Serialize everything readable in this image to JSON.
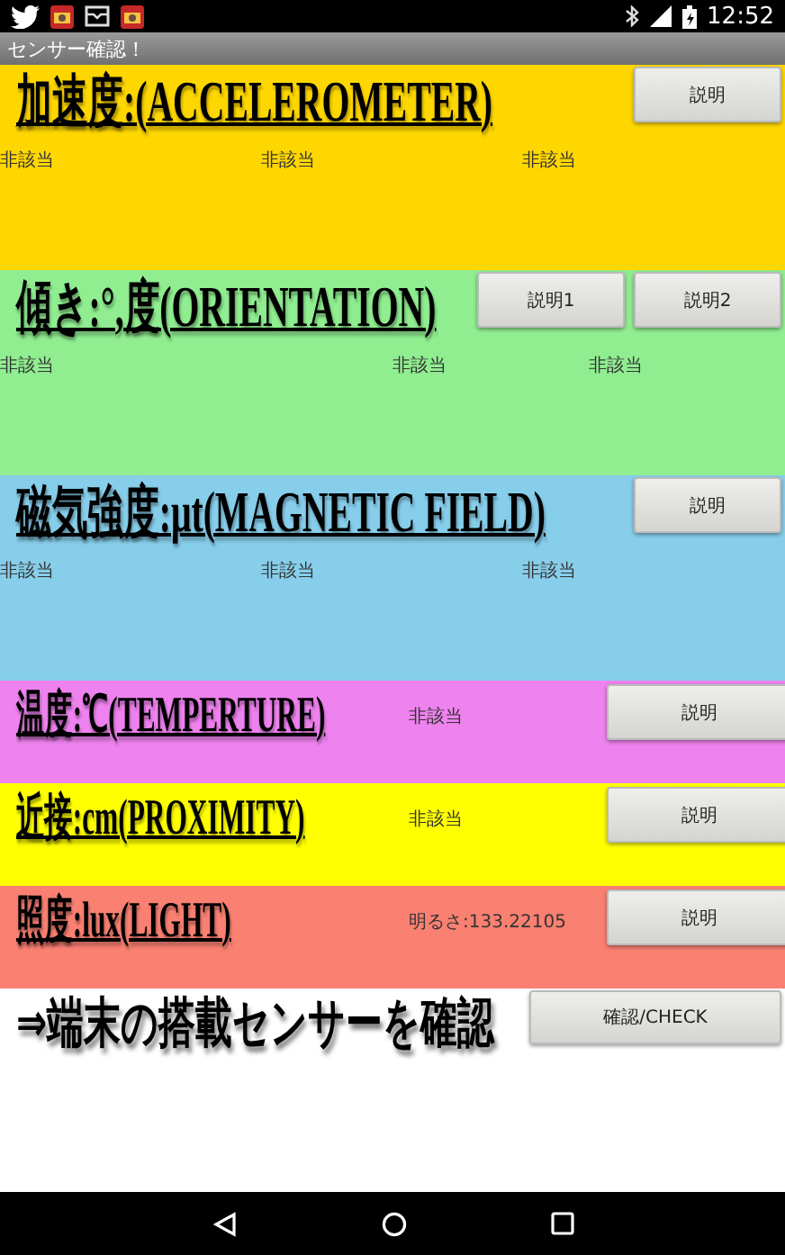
{
  "status_bar": {
    "time": "12:52"
  },
  "app_bar": {
    "title": "センサー確認！"
  },
  "sections": [
    {
      "kind": "wide",
      "color": "#ffd700",
      "title": "加速度:(ACCELEROMETER)",
      "buttons": [
        "説明"
      ],
      "readings": [
        "非該当",
        "非該当",
        "非該当"
      ]
    },
    {
      "kind": "wide",
      "color": "#90ee90",
      "title": "傾き:°,度(ORIENTATION)",
      "buttons": [
        "説明1",
        "説明2"
      ],
      "readings": [
        "非該当",
        "非該当",
        "非該当"
      ]
    },
    {
      "kind": "wide",
      "color": "#87ceeb",
      "title": "磁気強度:μt(MAGNETIC FIELD)",
      "buttons": [
        "説明"
      ],
      "readings": [
        "非該当",
        "非該当",
        "非該当"
      ]
    },
    {
      "kind": "compact",
      "color": "#ee82ee",
      "title": "温度:℃(TEMPERTURE)",
      "buttons": [
        "説明"
      ],
      "readings": [
        "非該当"
      ]
    },
    {
      "kind": "compact",
      "color": "#ffff00",
      "title": "近接:cm(PROXIMITY)",
      "buttons": [
        "説明"
      ],
      "readings": [
        "非該当"
      ]
    },
    {
      "kind": "compact",
      "color": "#fa8072",
      "title": "照度:lux(LIGHT)",
      "buttons": [
        "説明"
      ],
      "readings": [
        "明るさ:133.22105"
      ]
    },
    {
      "kind": "check",
      "color": "#ffffff",
      "title": "⇒端末の搭載センサーを確認",
      "buttons": [
        "確認/CHECK"
      ]
    }
  ]
}
